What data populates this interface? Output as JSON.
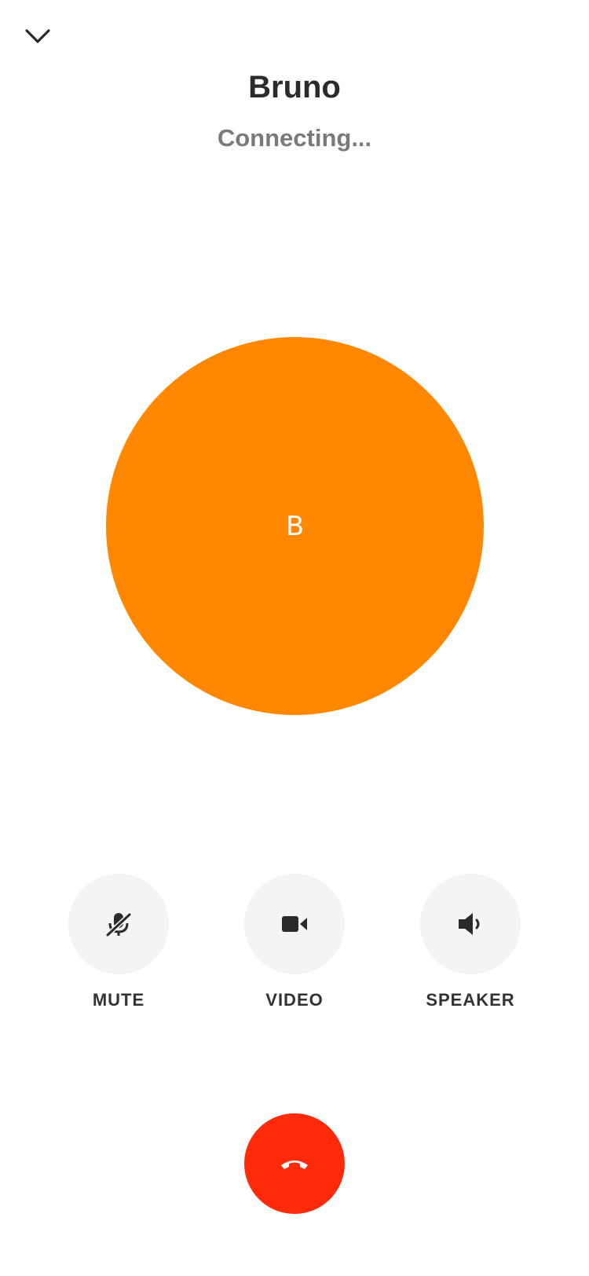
{
  "caller": {
    "name": "Bruno",
    "status": "Connecting...",
    "initial": "B",
    "avatar_color": "#FF8800"
  },
  "controls": [
    {
      "label": "MUTE",
      "icon": "mic-off-icon"
    },
    {
      "label": "VIDEO",
      "icon": "video-camera-icon"
    },
    {
      "label": "SPEAKER",
      "icon": "speaker-icon"
    }
  ],
  "header": {
    "collapse_icon": "chevron-down-icon"
  },
  "end_call": {
    "icon": "phone-hangup-icon",
    "color": "#FF2A0A"
  }
}
